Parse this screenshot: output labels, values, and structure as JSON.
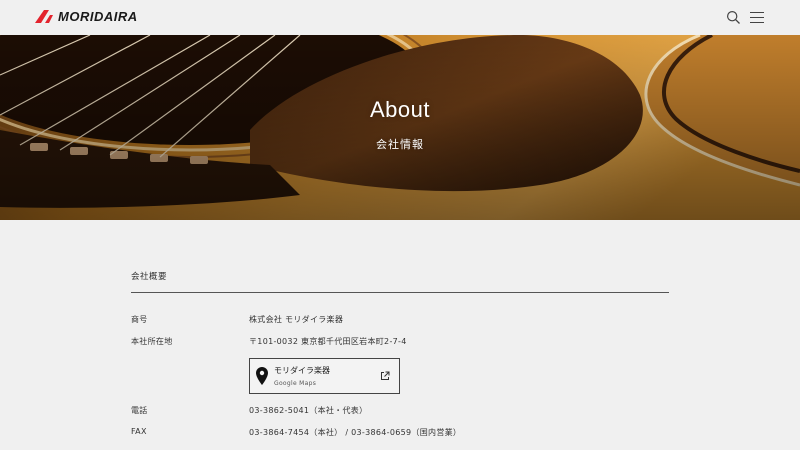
{
  "header": {
    "logo_text": "MORIDAIRA",
    "brand_color": "#e3232d",
    "search_icon": "search-icon",
    "menu_icon": "hamburger-menu-icon"
  },
  "hero": {
    "title": "About",
    "subtitle": "会社情報"
  },
  "company": {
    "heading": "会社概要",
    "rows": [
      {
        "label": "商号",
        "value": "株式会社 モリダイラ楽器"
      },
      {
        "label": "本社所在地",
        "value": "〒101-0032 東京都千代田区岩本町2-7-4"
      },
      {
        "label": "電話",
        "value": "03-3862-5041（本社・代表）"
      },
      {
        "label": "FAX",
        "value": "03-3864-7454（本社） / 03-3864-0659（国内営業）"
      }
    ],
    "map_card": {
      "name": "モリダイラ楽器",
      "service": "Google Maps",
      "pin_icon": "map-pin-icon",
      "external_icon": "external-link-icon"
    }
  }
}
